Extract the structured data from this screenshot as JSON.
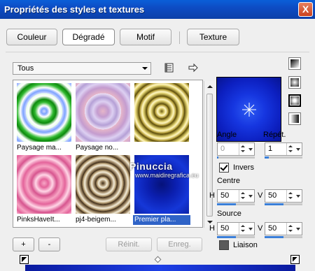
{
  "window": {
    "title": "Propriétés des styles et textures",
    "close_label": "X"
  },
  "tabs": [
    {
      "label": "Couleur",
      "active": false
    },
    {
      "label": "Dégradé",
      "active": true
    },
    {
      "label": "Motif",
      "active": false
    },
    {
      "label": "Texture",
      "active": false
    }
  ],
  "category": {
    "selected": "Tous"
  },
  "gallery": {
    "items": [
      {
        "caption": "Paysage ma...",
        "style": "green-rings",
        "selected": false
      },
      {
        "caption": "Paysage no...",
        "style": "lavender-rings",
        "selected": false
      },
      {
        "caption": "",
        "style": "gold-rings",
        "selected": false
      },
      {
        "caption": "PinksHaveIt...",
        "style": "pink-rings",
        "selected": false
      },
      {
        "caption": "pj4-beigem...",
        "style": "beige-rings",
        "selected": false
      },
      {
        "caption": "Premier pla...",
        "style": "blue-radial",
        "selected": true
      }
    ]
  },
  "gallery_buttons": {
    "add": "+",
    "remove": "-",
    "reset": "Réinit.",
    "save": "Enreg."
  },
  "watermark": {
    "name": "Pinuccia",
    "url": "www.maidiregrafica.eu"
  },
  "controls": {
    "angle_label": "Angle",
    "angle_value": "0",
    "repeat_label": "Répét.",
    "repeat_value": "1",
    "invert_label": "Invers",
    "invert_checked": true,
    "center_label": "Centre",
    "center_h_label": "H",
    "center_h_value": "50",
    "center_v_label": "V",
    "center_v_value": "50",
    "source_label": "Source",
    "source_h_label": "H",
    "source_h_value": "50",
    "source_v_label": "V",
    "source_v_value": "50",
    "link_label": "Liaison",
    "link_checked": false
  },
  "gradient_styles": [
    "linear-style",
    "rectangular-style",
    "sunburst-style",
    "radial-style"
  ],
  "colors": {
    "accent": "#2f63c7",
    "gradient_dark": "#0a1a9e",
    "gradient_light": "#1d3fe6"
  }
}
